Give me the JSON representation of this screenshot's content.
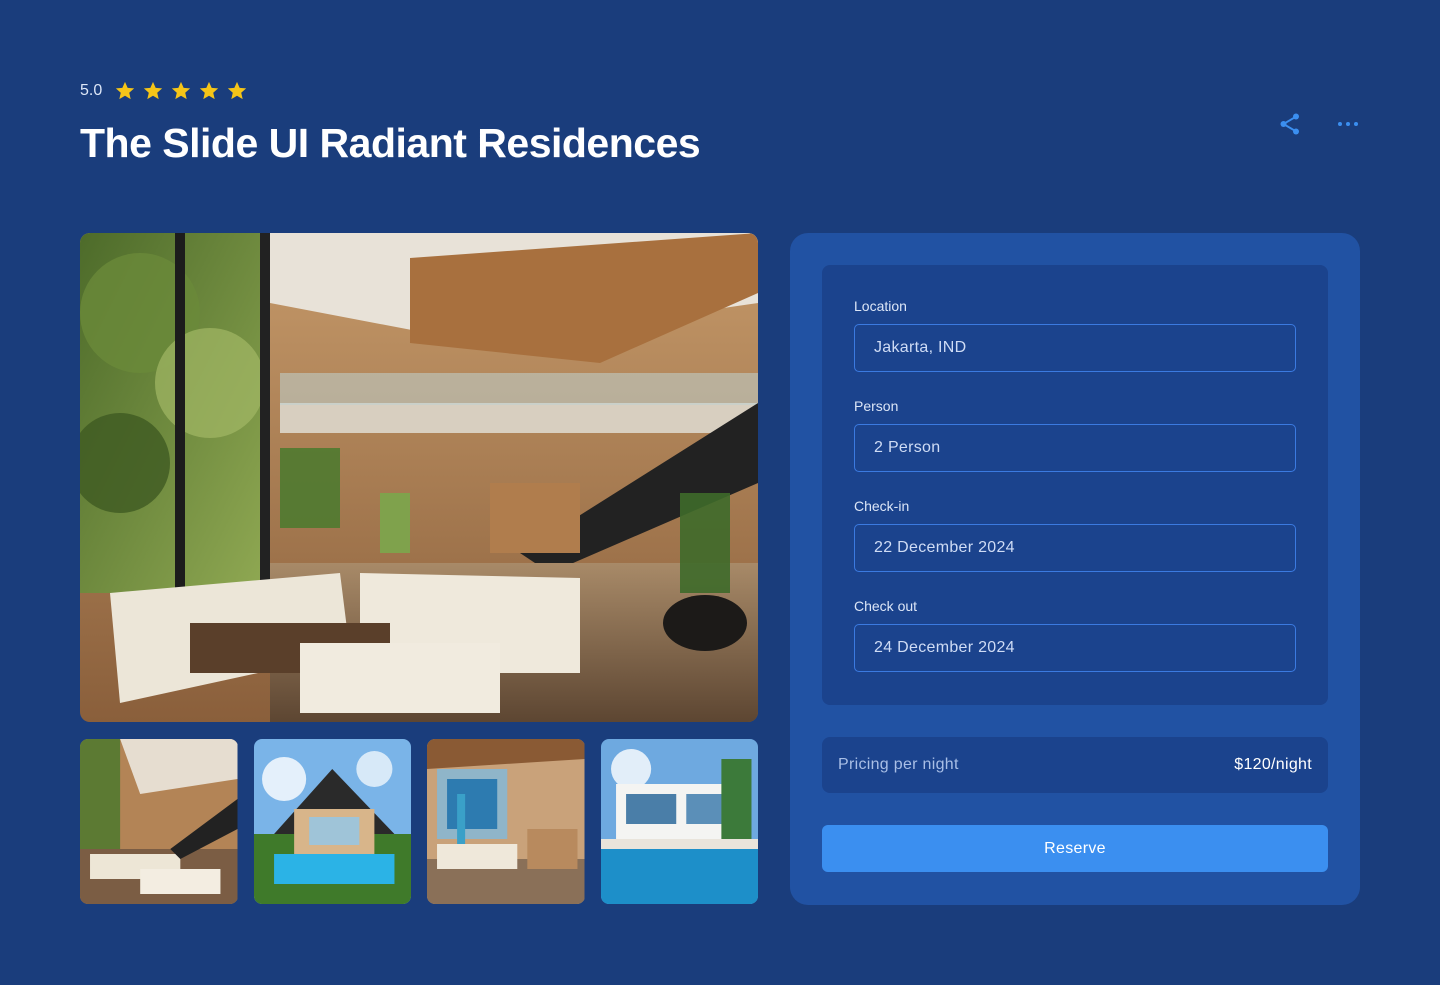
{
  "header": {
    "rating_value": "5.0",
    "stars": 5,
    "title": "The Slide UI Radiant Residences",
    "actions": [
      "share-icon",
      "more-icon"
    ]
  },
  "gallery": {
    "main_image": "living-room-photo",
    "thumbnails": [
      "living-room-thumb",
      "house-pool-thumb",
      "beach-interior-thumb",
      "modern-villa-pool-thumb"
    ]
  },
  "booking": {
    "location": {
      "label": "Location",
      "value": "Jakarta, IND"
    },
    "person": {
      "label": "Person",
      "value": "2 Person"
    },
    "checkin": {
      "label": "Check-in",
      "value": "22 December 2024"
    },
    "checkout": {
      "label": "Check out",
      "value": "24 December 2024"
    },
    "pricing": {
      "label": "Pricing per night",
      "value": "$120/night"
    },
    "reserve_label": "Reserve"
  },
  "colors": {
    "background": "#1a3d7c",
    "panel": "#2152a3",
    "inner_panel": "#1b438d",
    "accent": "#3b8ff0",
    "star": "#f5c518"
  }
}
